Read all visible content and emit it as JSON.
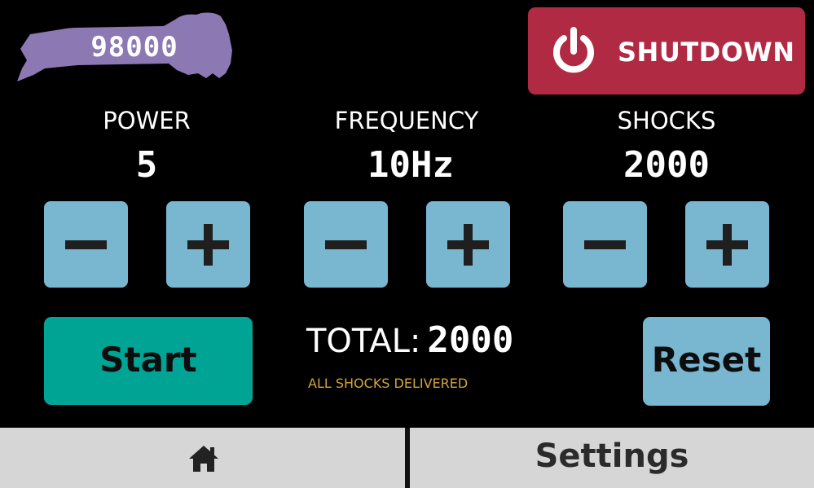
{
  "header": {
    "counter_value": "98000",
    "counter_color": "#8c78b3",
    "shutdown_label": "SHUTDOWN",
    "shutdown_color": "#b02a43",
    "shutdown_icon": "power-icon"
  },
  "params": {
    "power": {
      "title": "POWER",
      "value": "5"
    },
    "frequency": {
      "title": "FREQUENCY",
      "value": "10Hz"
    },
    "shocks": {
      "title": "SHOCKS",
      "value": "2000"
    }
  },
  "controls": {
    "decrement_icon": "minus-icon",
    "increment_icon": "plus-icon",
    "button_color": "#79b6d0"
  },
  "actions": {
    "start_label": "Start",
    "start_color": "#00a495",
    "reset_label": "Reset"
  },
  "summary": {
    "total_label": "TOTAL:",
    "total_value": "2000",
    "status": "ALL SHOCKS DELIVERED",
    "status_color": "#d4a43a"
  },
  "nav": {
    "home_icon": "home-icon",
    "settings_label": "Settings"
  }
}
